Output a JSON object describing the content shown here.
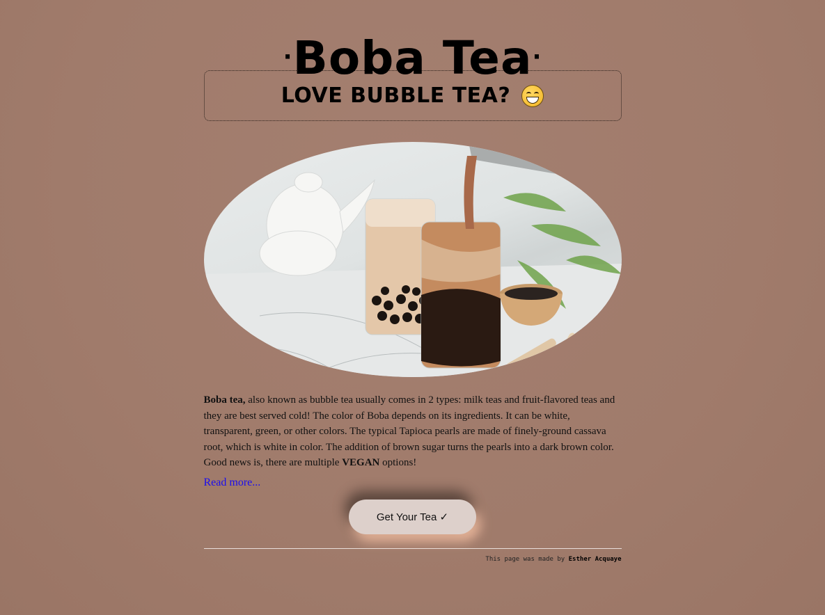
{
  "header": {
    "title": "Boba Tea",
    "title_dot": "·"
  },
  "banner": {
    "text": "LOVE BUBBLE TEA?",
    "emoji_icon": "grinning-face-emoji"
  },
  "photo": {
    "icon": "bubble-tea-photo"
  },
  "description": {
    "lead_bold": "Boba tea,",
    "text_part1": " also known as bubble tea usually comes in 2 types: milk teas and fruit-flavored teas and they are best served cold! The color of Boba depends on its ingredients. It can be white, transparent, green, or other colors. The typical Tapioca pearls are made of finely-ground cassava root, which is white in color. The addition of brown sugar turns the pearls into a dark brown color. Good news is, there are multiple ",
    "vegan_bold": "VEGAN",
    "text_part2": " options!"
  },
  "read_more": {
    "label": "Read more..."
  },
  "cta": {
    "label": "Get Your Tea ✓"
  },
  "footer": {
    "prefix": "This page was made by ",
    "author": "Esther Acquaye"
  },
  "colors": {
    "background": "#a07b6b",
    "button_bg": "#ddd0cb",
    "link": "#1a0dee",
    "rule": "#e9dfdb"
  }
}
